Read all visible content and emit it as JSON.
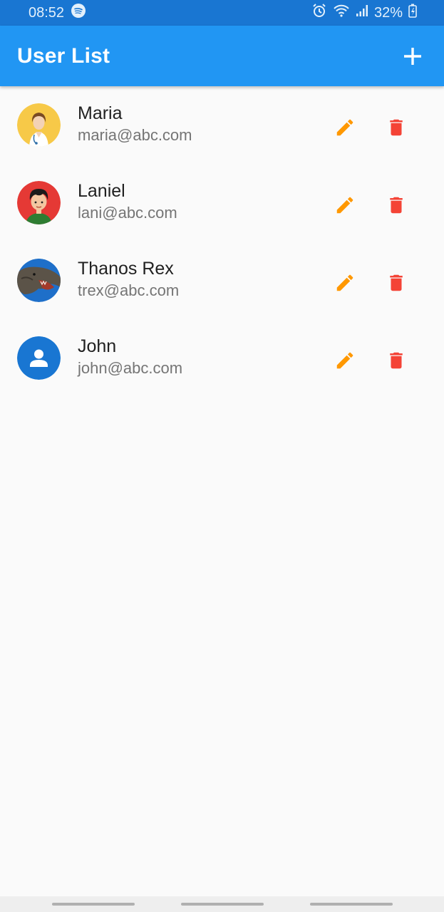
{
  "status_bar": {
    "time": "08:52",
    "battery": "32%",
    "icons": [
      "spotify-icon",
      "alarm-icon",
      "wifi-icon",
      "signal-icon",
      "battery-charging-icon"
    ]
  },
  "app_bar": {
    "title": "User List",
    "add_icon": "add-icon"
  },
  "users": [
    {
      "name": "Maria",
      "email": "maria@abc.com",
      "avatar": "doctor-avatar"
    },
    {
      "name": "Laniel",
      "email": "lani@abc.com",
      "avatar": "boy-avatar"
    },
    {
      "name": "Thanos Rex",
      "email": "trex@abc.com",
      "avatar": "dinosaur-avatar"
    },
    {
      "name": "John",
      "email": "john@abc.com",
      "avatar": "default-person-avatar"
    }
  ],
  "colors": {
    "status_bar": "#1976d2",
    "app_bar": "#2196f3",
    "edit": "#ff9800",
    "delete": "#f44336"
  }
}
